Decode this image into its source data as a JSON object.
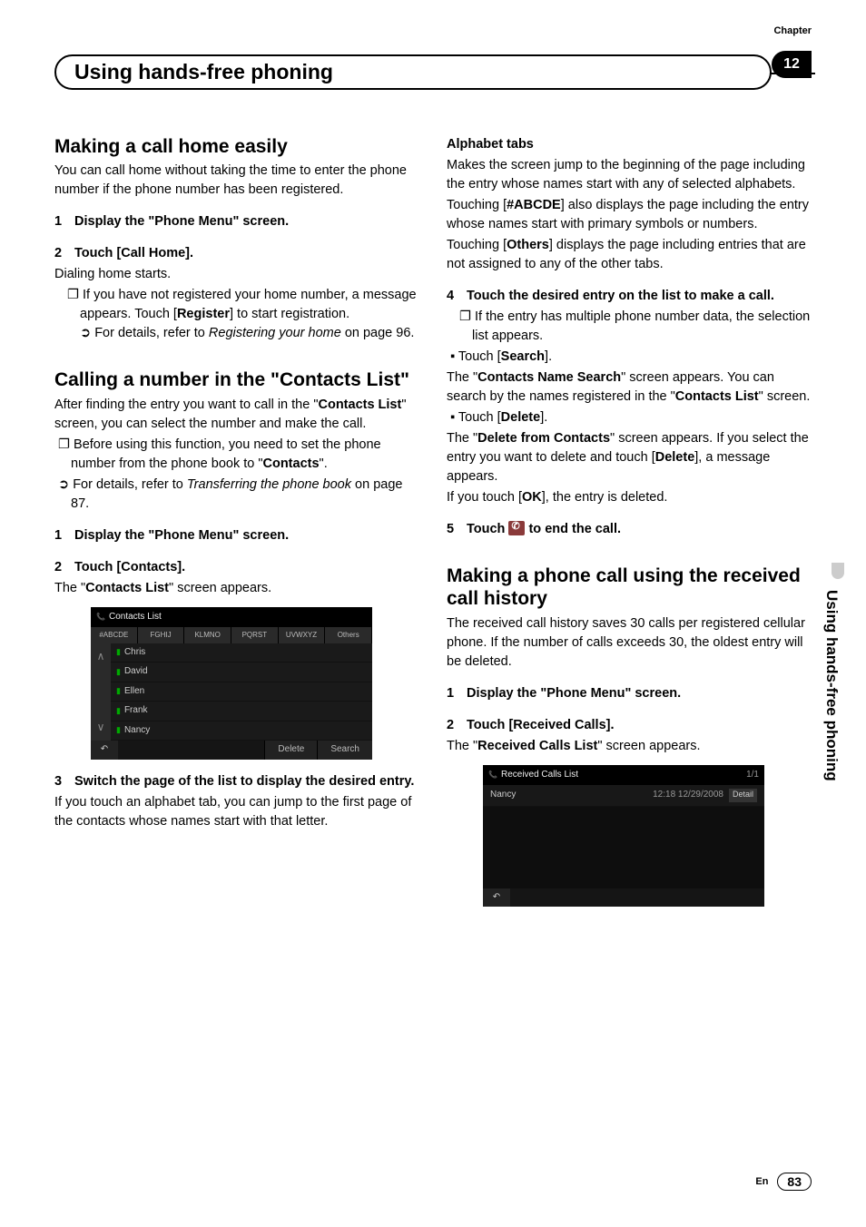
{
  "chapter_label": "Chapter",
  "chapter_number": "12",
  "header_title": "Using hands-free phoning",
  "side_text": "Using hands-free phoning",
  "footer_lang": "En",
  "footer_page": "83",
  "left": {
    "h1": "Making a call home easily",
    "p1": "You can call home without taking the time to enter the phone number if the phone number has been registered.",
    "s1": "Display the \"Phone Menu\" screen.",
    "s2": "Touch [Call Home].",
    "p2": "Dialing home starts.",
    "b1a": "If you have not registered your home number, a message appears. Touch [",
    "b1b": "Register",
    "b1c": "] to start registration.",
    "b2a": "For details, refer to ",
    "b2b": "Registering your home",
    "b2c": " on page 96.",
    "h2": "Calling a number in the \"Contacts List\"",
    "p3a": "After finding the entry you want to call in the \"",
    "p3b": "Contacts List",
    "p3c": "\" screen, you can select the number and make the call.",
    "b3a": "Before using this function, you need to set the phone number from the phone book to \"",
    "b3b": "Contacts",
    "b3c": "\".",
    "b4a": "For details, refer to ",
    "b4b": "Transferring the phone book",
    "b4c": " on page 87.",
    "s3": "Display the \"Phone Menu\" screen.",
    "s4": "Touch [Contacts].",
    "p4a": "The \"",
    "p4b": "Contacts List",
    "p4c": "\" screen appears.",
    "s5": "Switch the page of the list to display the desired entry.",
    "p5": "If you touch an alphabet tab, you can jump to the first page of the contacts whose names start with that letter.",
    "ss1": {
      "title": "Contacts List",
      "tabs": [
        "#ABCDE",
        "FGHIJ",
        "KLMNO",
        "PQRST",
        "UVWXYZ",
        "Others"
      ],
      "rows": [
        "Chris",
        "David",
        "Ellen",
        "Frank",
        "Nancy"
      ],
      "delete": "Delete",
      "search": "Search"
    }
  },
  "right": {
    "h1": "Alphabet tabs",
    "p1": "Makes the screen jump to the beginning of the page including the entry whose names start with any of selected alphabets.",
    "p2a": "Touching [",
    "p2b": "#ABCDE",
    "p2c": "] also displays the page including the entry whose names start with primary symbols or numbers.",
    "p3a": "Touching [",
    "p3b": "Others",
    "p3c": "] displays the page including entries that are not assigned to any of the other tabs.",
    "s4": "Touch the desired entry on the list to make a call.",
    "b1": "If the entry has multiple phone number data, the selection list appears.",
    "b2a": "Touch [",
    "b2b": "Search",
    "b2c": "].",
    "p4a": "The \"",
    "p4b": "Contacts Name Search",
    "p4c": "\" screen appears. You can search by the names registered in the \"",
    "p4d": "Contacts List",
    "p4e": "\" screen.",
    "b3a": "Touch [",
    "b3b": "Delete",
    "b3c": "].",
    "p5a": "The \"",
    "p5b": "Delete from Contacts",
    "p5c": "\" screen appears. If you select the entry you want to delete and touch [",
    "p5d": "Delete",
    "p5e": "], a message appears.",
    "p6a": "If you touch [",
    "p6b": "OK",
    "p6c": "], the entry is deleted.",
    "s5a": "Touch ",
    "s5b": " to end the call.",
    "h2": "Making a phone call using the received call history",
    "p7": "The received call history saves 30 calls per registered cellular phone. If the number of calls exceeds 30, the oldest entry will be deleted.",
    "s6": "Display the \"Phone Menu\" screen.",
    "s7": "Touch [Received Calls].",
    "p8a": "The \"",
    "p8b": "Received Calls List",
    "p8c": "\" screen appears.",
    "ss2": {
      "title": "Received Calls List",
      "page": "1/1",
      "name": "Nancy",
      "time": "12:18 12/29/2008",
      "detail": "Detail"
    }
  }
}
